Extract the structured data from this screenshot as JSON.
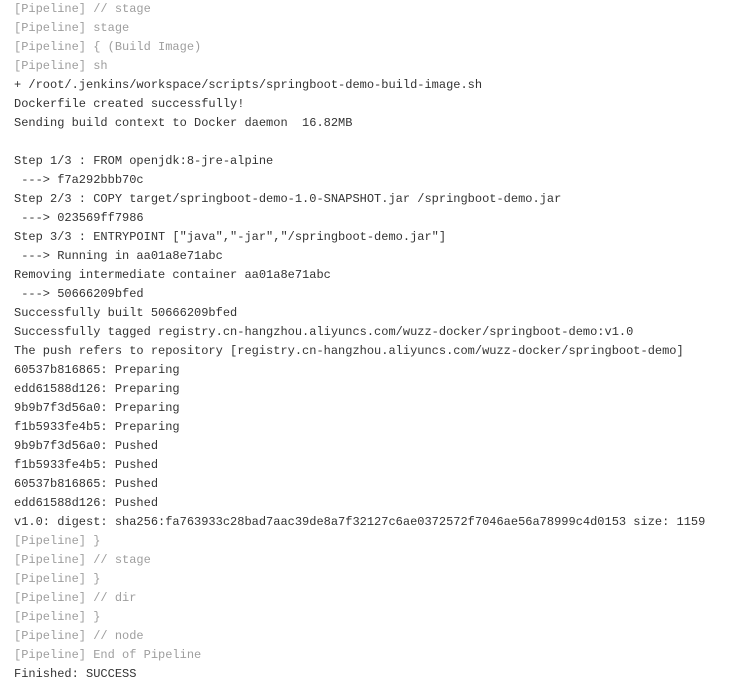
{
  "lines": [
    {
      "text": "[Pipeline] // stage",
      "type": "pipeline"
    },
    {
      "text": "[Pipeline] stage",
      "type": "pipeline"
    },
    {
      "text": "[Pipeline] { (Build Image)",
      "type": "pipeline"
    },
    {
      "text": "[Pipeline] sh",
      "type": "pipeline"
    },
    {
      "text": "+ /root/.jenkins/workspace/scripts/springboot-demo-build-image.sh",
      "type": "normal"
    },
    {
      "text": "Dockerfile created successfully!",
      "type": "normal"
    },
    {
      "text": "Sending build context to Docker daemon  16.82MB",
      "type": "normal"
    },
    {
      "text": "",
      "type": "normal"
    },
    {
      "text": "Step 1/3 : FROM openjdk:8-jre-alpine",
      "type": "normal"
    },
    {
      "text": " ---> f7a292bbb70c",
      "type": "normal"
    },
    {
      "text": "Step 2/3 : COPY target/springboot-demo-1.0-SNAPSHOT.jar /springboot-demo.jar",
      "type": "normal"
    },
    {
      "text": " ---> 023569ff7986",
      "type": "normal"
    },
    {
      "text": "Step 3/3 : ENTRYPOINT [\"java\",\"-jar\",\"/springboot-demo.jar\"]",
      "type": "normal"
    },
    {
      "text": " ---> Running in aa01a8e71abc",
      "type": "normal"
    },
    {
      "text": "Removing intermediate container aa01a8e71abc",
      "type": "normal"
    },
    {
      "text": " ---> 50666209bfed",
      "type": "normal"
    },
    {
      "text": "Successfully built 50666209bfed",
      "type": "normal"
    },
    {
      "text": "Successfully tagged registry.cn-hangzhou.aliyuncs.com/wuzz-docker/springboot-demo:v1.0",
      "type": "normal"
    },
    {
      "text": "The push refers to repository [registry.cn-hangzhou.aliyuncs.com/wuzz-docker/springboot-demo]",
      "type": "normal"
    },
    {
      "text": "60537b816865: Preparing",
      "type": "normal"
    },
    {
      "text": "edd61588d126: Preparing",
      "type": "normal"
    },
    {
      "text": "9b9b7f3d56a0: Preparing",
      "type": "normal"
    },
    {
      "text": "f1b5933fe4b5: Preparing",
      "type": "normal"
    },
    {
      "text": "9b9b7f3d56a0: Pushed",
      "type": "normal"
    },
    {
      "text": "f1b5933fe4b5: Pushed",
      "type": "normal"
    },
    {
      "text": "60537b816865: Pushed",
      "type": "normal"
    },
    {
      "text": "edd61588d126: Pushed",
      "type": "normal"
    },
    {
      "text": "v1.0: digest: sha256:fa763933c28bad7aac39de8a7f32127c6ae0372572f7046ae56a78999c4d0153 size: 1159",
      "type": "normal"
    },
    {
      "text": "[Pipeline] }",
      "type": "pipeline"
    },
    {
      "text": "[Pipeline] // stage",
      "type": "pipeline"
    },
    {
      "text": "[Pipeline] }",
      "type": "pipeline"
    },
    {
      "text": "[Pipeline] // dir",
      "type": "pipeline"
    },
    {
      "text": "[Pipeline] }",
      "type": "pipeline"
    },
    {
      "text": "[Pipeline] // node",
      "type": "pipeline"
    },
    {
      "text": "[Pipeline] End of Pipeline",
      "type": "pipeline"
    },
    {
      "text": "Finished: SUCCESS",
      "type": "normal"
    }
  ]
}
